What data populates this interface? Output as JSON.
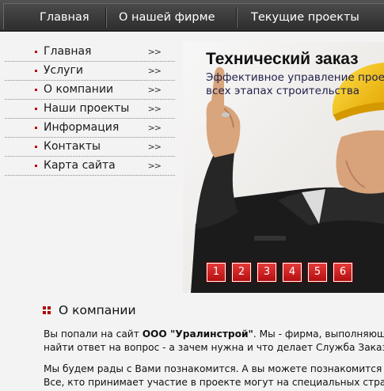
{
  "top_nav": {
    "items": [
      "Главная",
      "О нашей фирме",
      "Текущие проекты"
    ]
  },
  "side_menu": {
    "arrow": ">>",
    "items": [
      "Главная",
      "Услуги",
      "О компании",
      "Наши проекты",
      "Информация",
      "Контакты",
      "Карта сайта"
    ]
  },
  "banner": {
    "title": "Технический заказ",
    "subtitle_line1": "Эффективное управление прое",
    "subtitle_line2": "всех этапах строительства",
    "pages": [
      "1",
      "2",
      "3",
      "4",
      "5",
      "6"
    ]
  },
  "about": {
    "heading": "О компании",
    "p1_prefix": "Вы попали на сайт ",
    "p1_company": "ООО \"Уралинстрой\"",
    "p1_suffix": ". Мы - фирма, выполняюща",
    "p1_line2": "найти ответ на вопрос - а зачем нужна и что делает Служба Заказч",
    "p2_line1": "Мы будем рады с Вами познакомится. А вы можете познакомится",
    "p2_line2": "Все, кто принимает участие в проекте могут на специальных стра"
  },
  "colors": {
    "accent_red": "#c00000",
    "nav_dark": "#3a3a3a",
    "page_bg": "#f3f3f3"
  }
}
